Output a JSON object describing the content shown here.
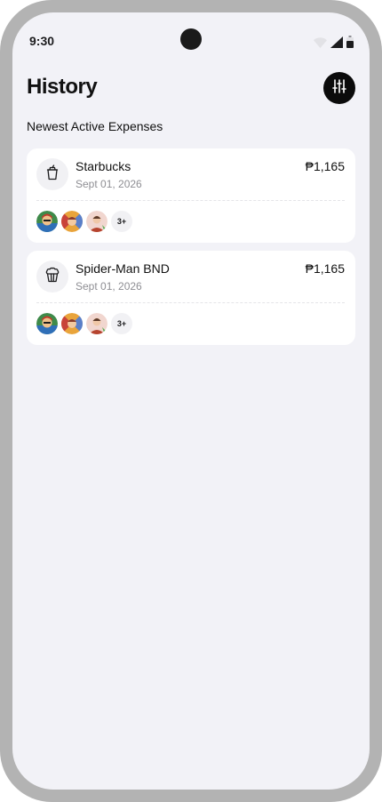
{
  "status_bar": {
    "time": "9:30",
    "icons": [
      "wifi-icon",
      "signal-icon",
      "battery-icon"
    ]
  },
  "header": {
    "title": "History",
    "filter_icon": "sliders-icon",
    "filter_button_color": "#0b0b0b"
  },
  "section": {
    "title": "Newest Active Expenses"
  },
  "expenses": [
    {
      "name": "Starbucks",
      "date": "Sept 01, 2026",
      "amount": "₱1,165",
      "icon": "cup-icon",
      "participants": [
        "avatar-1",
        "avatar-2",
        "avatar-3"
      ],
      "more_count": "3+"
    },
    {
      "name": "Spider-Man BND",
      "date": "Sept 01, 2026",
      "amount": "₱1,165",
      "icon": "popcorn-icon",
      "participants": [
        "avatar-1",
        "avatar-2",
        "avatar-3"
      ],
      "more_count": "3+"
    }
  ],
  "colors": {
    "background": "#f2f2f7",
    "card": "#ffffff",
    "secondary_text": "#8e8e93",
    "frame": "#b3b3b3"
  }
}
